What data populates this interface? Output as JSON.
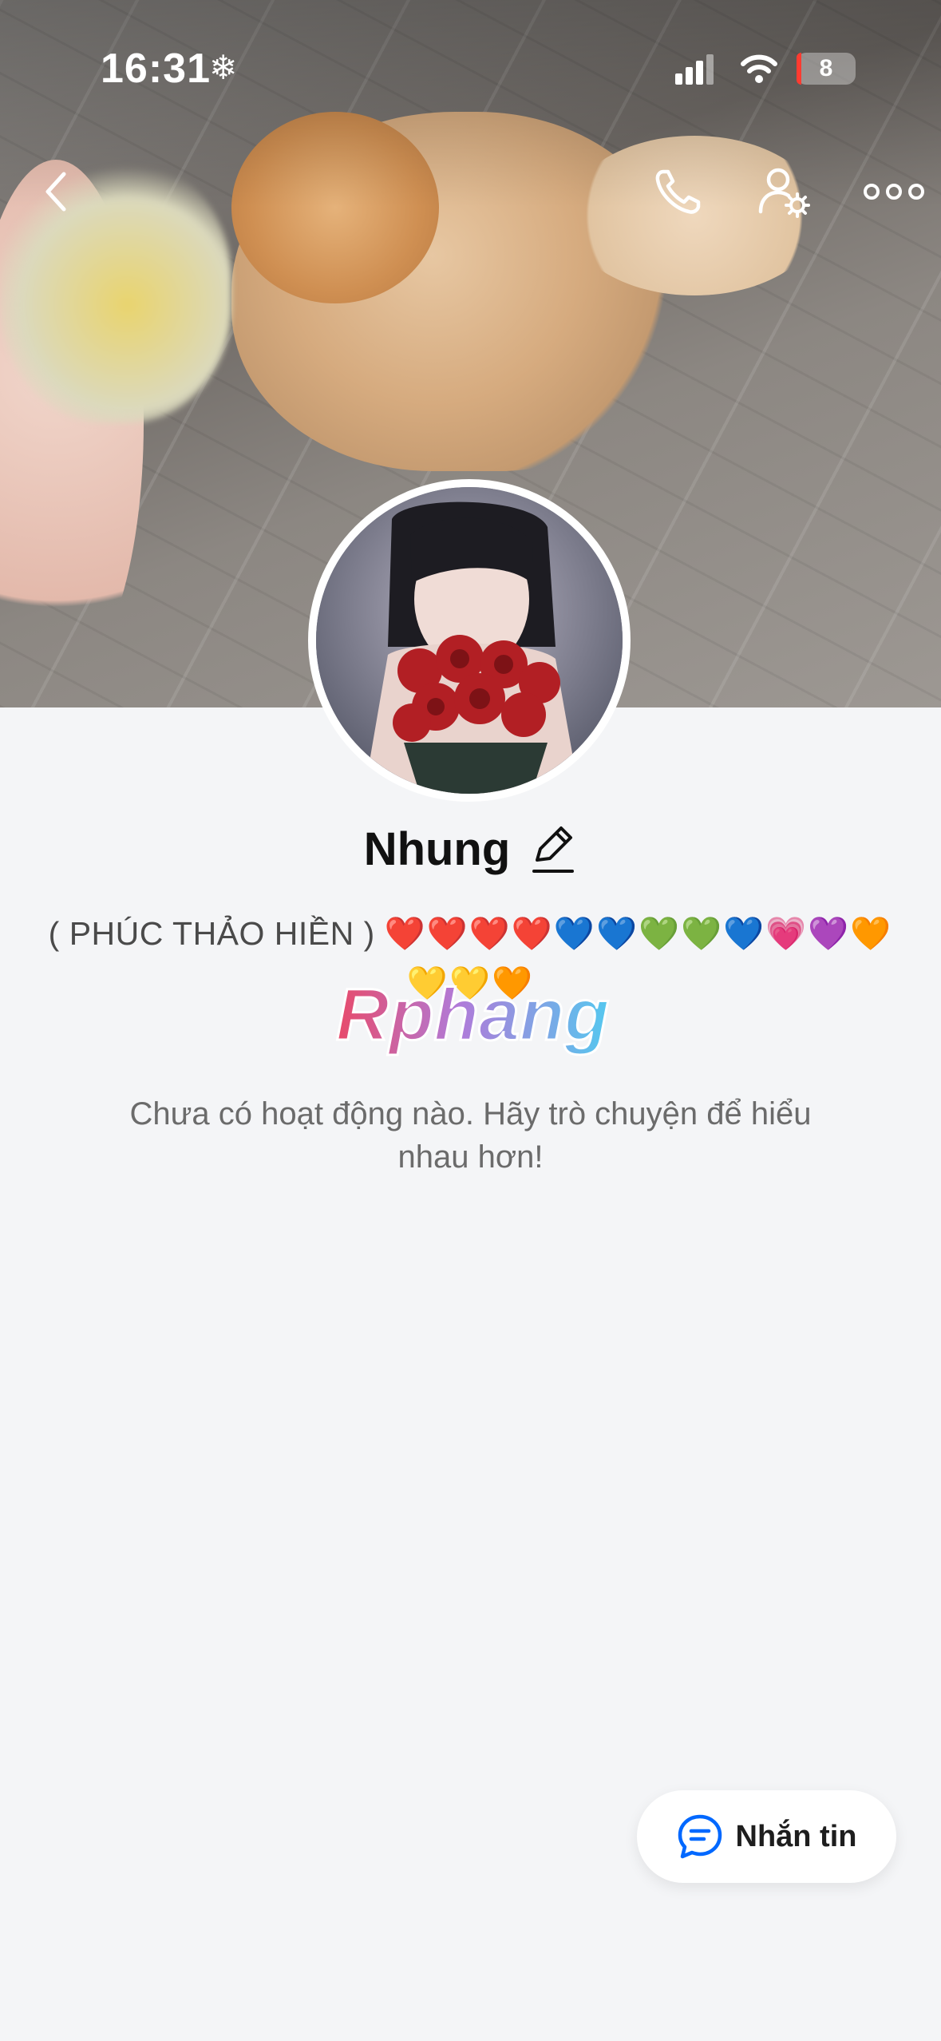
{
  "status_bar": {
    "time": "16:31",
    "focus_symbol": "❄",
    "battery": "8",
    "icons": [
      "signal-icon",
      "wifi-icon",
      "battery-icon"
    ]
  },
  "header": {
    "icons": [
      "back-chevron-icon",
      "phone-icon",
      "user-settings-icon",
      "more-dots-icon"
    ]
  },
  "profile": {
    "name": "Nhung",
    "bio_text": "( PHÚC THẢO HIỀN )",
    "bio_hearts": "❤️❤️❤️❤️💙💙💚💚💙💗💜🧡💛💛🧡",
    "watermark": "Rphang",
    "empty_message": "Chưa có hoạt động nào. Hãy trò chuyện để hiểu nhau hơn!"
  },
  "actions": {
    "message_label": "Nhắn tin"
  },
  "colors": {
    "accent": "#0068ff",
    "background": "#f4f5f7"
  }
}
